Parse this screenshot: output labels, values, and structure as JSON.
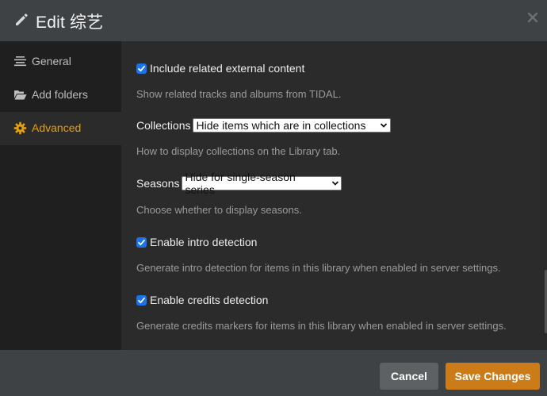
{
  "header": {
    "title": "Edit 综艺",
    "edit_icon": "pencil-icon",
    "close_icon": "close-icon"
  },
  "sidebar": {
    "items": [
      {
        "label": "General",
        "icon": "align-lines-icon",
        "active": false
      },
      {
        "label": "Add folders",
        "icon": "folder-open-icon",
        "active": false
      },
      {
        "label": "Advanced",
        "icon": "gear-icon",
        "active": true
      }
    ]
  },
  "settings": {
    "external": {
      "label": "Include related external content",
      "checked": true,
      "help": "Show related tracks and albums from TIDAL."
    },
    "collections": {
      "label": "Collections",
      "value": "Hide items which are in collections",
      "help": "How to display collections on the Library tab."
    },
    "seasons": {
      "label": "Seasons",
      "value": "Hide for single-season series",
      "help": "Choose whether to display seasons."
    },
    "intro": {
      "label": "Enable intro detection",
      "checked": true,
      "help": "Generate intro detection for items in this library when enabled in server settings."
    },
    "credits": {
      "label": "Enable credits detection",
      "checked": true,
      "help": "Generate credits markers for items in this library when enabled in server settings."
    }
  },
  "footer": {
    "cancel_label": "Cancel",
    "save_label": "Save Changes"
  },
  "colors": {
    "accent": "#e5a00d",
    "save_button": "#cc7b19",
    "checkbox": "#1a73e8"
  }
}
